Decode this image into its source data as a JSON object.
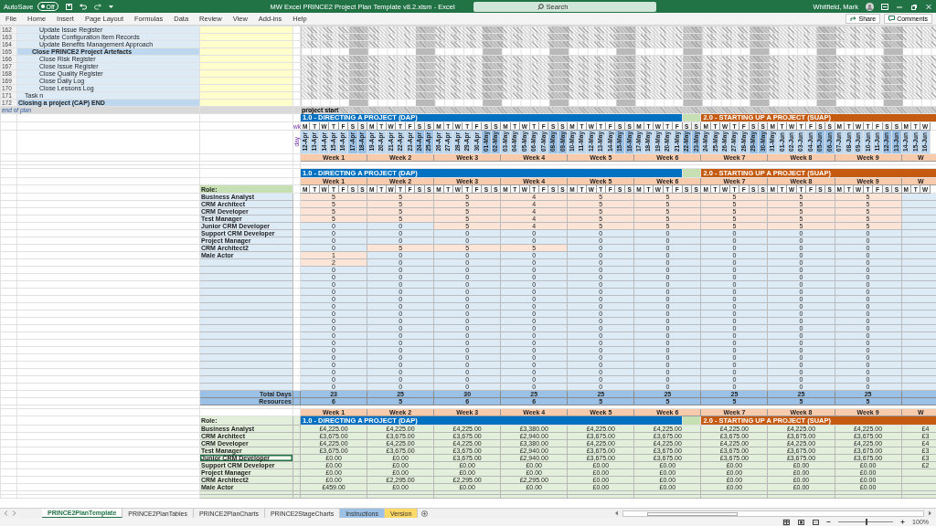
{
  "title_bar": {
    "autosave_label": "AutoSave",
    "autosave": {
      "label": "Off",
      "on": false
    },
    "title": "MW Excel PRINCE2 Project Plan Template v8.2.xlsm  -  Excel",
    "search": {
      "placeholder": "Search"
    },
    "user": "Whitfield, Mark"
  },
  "ribbon_tabs": [
    "File",
    "Home",
    "Insert",
    "Page Layout",
    "Formulas",
    "Data",
    "Review",
    "View",
    "Add-ins",
    "Help"
  ],
  "ribbon_buttons": [
    "Share",
    "Comments"
  ],
  "task_rows": [
    {
      "row": "162",
      "text": "Update Issue Register",
      "kind": "task"
    },
    {
      "row": "163",
      "text": "Update Configuration Item Records",
      "kind": "task"
    },
    {
      "row": "164",
      "text": "Update Benefits Management Approach",
      "kind": "task"
    },
    {
      "row": "165",
      "text": "Close PRINCE2 Project Artefacts",
      "kind": "activity",
      "children": [
        {
          "row": "166",
          "text": "Close Risk Register",
          "kind": "task"
        },
        {
          "row": "167",
          "text": "Close Issue Register",
          "kind": "task"
        },
        {
          "row": "168",
          "text": "Close Quality Register",
          "kind": "task"
        },
        {
          "row": "169",
          "text": "Close Daily Log",
          "kind": "task"
        },
        {
          "row": "170",
          "text": "Close Lessons Log",
          "kind": "task"
        }
      ]
    },
    {
      "row": "171",
      "text": "Task n",
      "kind": "custom"
    },
    {
      "row": "172",
      "text": "Closing a project (CAP) END",
      "kind": "process_end"
    }
  ],
  "end_of_plan": "end of plan",
  "project_start": "project start",
  "timeline": {
    "row_labels": [
      "wk",
      "day"
    ],
    "phases": [
      {
        "label": "1.0 - DIRECTING A PROJECT (DAP)",
        "color": "#0070c0"
      },
      {
        "label": "2.0 - STARTING UP A PROJECT (SUAP)",
        "color": "#c55a11"
      }
    ],
    "weeks": [
      {
        "label": "Week 1",
        "days": [
          "M",
          "T",
          "W",
          "T",
          "F",
          "S",
          "S"
        ],
        "dates": [
          "12-Apr",
          "13-Apr",
          "14-Apr",
          "15-Apr",
          "16-Apr",
          "17-Apr",
          "18-Apr"
        ]
      },
      {
        "label": "Week 2",
        "days": [
          "M",
          "T",
          "W",
          "T",
          "F",
          "S",
          "S"
        ],
        "dates": [
          "19-Apr",
          "20-Apr",
          "21-Apr",
          "22-Apr",
          "23-Apr",
          "24-Apr",
          "25-Apr"
        ]
      },
      {
        "label": "Week 3",
        "days": [
          "M",
          "T",
          "W",
          "T",
          "F",
          "S",
          "S"
        ],
        "dates": [
          "26-Apr",
          "27-Apr",
          "28-Apr",
          "29-Apr",
          "30-Apr",
          "01-May",
          "02-May"
        ]
      },
      {
        "label": "Week 4",
        "days": [
          "M",
          "T",
          "W",
          "T",
          "F",
          "S",
          "S"
        ],
        "dates": [
          "03-May",
          "04-May",
          "05-May",
          "06-May",
          "07-May",
          "08-May",
          "09-May"
        ]
      },
      {
        "label": "Week 5",
        "days": [
          "M",
          "T",
          "W",
          "T",
          "F",
          "S",
          "S"
        ],
        "dates": [
          "10-May",
          "11-May",
          "12-May",
          "13-May",
          "14-May",
          "15-May",
          "16-May"
        ]
      },
      {
        "label": "Week 6",
        "days": [
          "M",
          "T",
          "W",
          "T",
          "F",
          "S",
          "S"
        ],
        "dates": [
          "17-May",
          "18-May",
          "19-May",
          "20-May",
          "21-May",
          "22-May",
          "23-May"
        ]
      },
      {
        "label": "Week 7",
        "days": [
          "M",
          "T",
          "W",
          "T",
          "F",
          "S",
          "S"
        ],
        "dates": [
          "24-May",
          "25-May",
          "26-May",
          "27-May",
          "28-May",
          "29-May",
          "30-May"
        ]
      },
      {
        "label": "Week 8",
        "days": [
          "M",
          "T",
          "W",
          "T",
          "F",
          "S",
          "S"
        ],
        "dates": [
          "31-May",
          "01-Jun",
          "02-Jun",
          "03-Jun",
          "04-Jun",
          "05-Jun",
          "06-Jun"
        ]
      },
      {
        "label": "Week 9",
        "days": [
          "M",
          "T",
          "W",
          "T",
          "F",
          "S",
          "S"
        ],
        "dates": [
          "07-Jun",
          "08-Jun",
          "09-Jun",
          "10-Jun",
          "11-Jun",
          "12-Jun",
          "13-Jun"
        ]
      },
      {
        "label": "W",
        "days": [
          "M",
          "T",
          "W"
        ],
        "dates": [
          "14-Jun",
          "15-Jun",
          "16-Jun"
        ]
      }
    ]
  },
  "resources": {
    "phases": [
      {
        "label": "1.0 - DIRECTING A PROJECT (DAP)",
        "color": "#0070c0"
      },
      {
        "label": "2.0 - STARTING UP A PROJECT (SUAP)",
        "color": "#c55a11"
      }
    ],
    "weeks": [
      {
        "label": "Week 1",
        "days": [
          "M",
          "T",
          "W",
          "T",
          "F",
          "S",
          "S"
        ]
      },
      {
        "label": "Week 2",
        "days": [
          "M",
          "T",
          "W",
          "T",
          "F",
          "S",
          "S"
        ]
      },
      {
        "label": "Week 3",
        "days": [
          "M",
          "T",
          "W",
          "T",
          "F",
          "S",
          "S"
        ]
      },
      {
        "label": "Week 4",
        "days": [
          "M",
          "T",
          "W",
          "T",
          "F",
          "S",
          "S"
        ]
      },
      {
        "label": "Week 5",
        "days": [
          "M",
          "T",
          "W",
          "T",
          "F",
          "S",
          "S"
        ]
      },
      {
        "label": "Week 6",
        "days": [
          "M",
          "T",
          "W",
          "T",
          "F",
          "S",
          "S"
        ]
      },
      {
        "label": "Week 7",
        "days": [
          "M",
          "T",
          "W",
          "T",
          "F",
          "S",
          "S"
        ]
      },
      {
        "label": "Week 8",
        "days": [
          "M",
          "T",
          "W",
          "T",
          "F",
          "S",
          "S"
        ]
      },
      {
        "label": "Week 9",
        "days": [
          "M",
          "T",
          "W",
          "T",
          "F",
          "S",
          "S"
        ]
      },
      {
        "label": "W",
        "days": [
          "M",
          "T",
          "W"
        ]
      }
    ],
    "role_label": "Role:",
    "rows": [
      {
        "role": "Business Analyst",
        "values": [
          "5",
          "5",
          "5",
          "4",
          "5",
          "5",
          "5",
          "5",
          "5"
        ]
      },
      {
        "role": "CRM Architect",
        "values": [
          "5",
          "5",
          "5",
          "4",
          "5",
          "5",
          "5",
          "5",
          "5"
        ]
      },
      {
        "role": "CRM Developer",
        "values": [
          "5",
          "5",
          "5",
          "4",
          "5",
          "5",
          "5",
          "5",
          "5"
        ]
      },
      {
        "role": "Test Manager",
        "values": [
          "5",
          "5",
          "5",
          "4",
          "5",
          "5",
          "5",
          "5",
          "5"
        ]
      },
      {
        "role": "Junior CRM Developer",
        "values": [
          "0",
          "0",
          "5",
          "4",
          "5",
          "5",
          "5",
          "5",
          "5"
        ]
      },
      {
        "role": "Support CRM Developer",
        "values": [
          "0",
          "0",
          "0",
          "0",
          "0",
          "0",
          "0",
          "0",
          "0"
        ]
      },
      {
        "role": "Project Manager",
        "values": [
          "0",
          "0",
          "0",
          "0",
          "0",
          "0",
          "0",
          "0",
          "0"
        ]
      },
      {
        "role": "CRM Architect2",
        "values": [
          "0",
          "5",
          "5",
          "5",
          "0",
          "0",
          "0",
          "0",
          "0"
        ]
      },
      {
        "role": "Male Actor",
        "values": [
          "1",
          "0",
          "0",
          "0",
          "0",
          "0",
          "0",
          "0",
          "0"
        ]
      },
      {
        "values": [
          "2",
          "0",
          "0",
          "0",
          "0",
          "0",
          "0",
          "0",
          "0"
        ]
      },
      {
        "values": [
          "0",
          "0",
          "0",
          "0",
          "0",
          "0",
          "0",
          "0",
          "0"
        ]
      },
      {
        "values": [
          "0",
          "0",
          "0",
          "0",
          "0",
          "0",
          "0",
          "0",
          "0"
        ]
      },
      {
        "values": [
          "0",
          "0",
          "0",
          "0",
          "0",
          "0",
          "0",
          "0",
          "0"
        ]
      },
      {
        "values": [
          "0",
          "0",
          "0",
          "0",
          "0",
          "0",
          "0",
          "0",
          "0"
        ]
      },
      {
        "values": [
          "0",
          "0",
          "0",
          "0",
          "0",
          "0",
          "0",
          "0",
          "0"
        ]
      },
      {
        "values": [
          "0",
          "0",
          "0",
          "0",
          "0",
          "0",
          "0",
          "0",
          "0"
        ]
      },
      {
        "values": [
          "0",
          "0",
          "0",
          "0",
          "0",
          "0",
          "0",
          "0",
          "0"
        ]
      },
      {
        "values": [
          "0",
          "0",
          "0",
          "0",
          "0",
          "0",
          "0",
          "0",
          "0"
        ]
      },
      {
        "values": [
          "0",
          "0",
          "0",
          "0",
          "0",
          "0",
          "0",
          "0",
          "0"
        ]
      },
      {
        "values": [
          "0",
          "0",
          "0",
          "0",
          "0",
          "0",
          "0",
          "0",
          "0"
        ]
      },
      {
        "values": [
          "0",
          "0",
          "0",
          "0",
          "0",
          "0",
          "0",
          "0",
          "0"
        ]
      },
      {
        "values": [
          "0",
          "0",
          "0",
          "0",
          "0",
          "0",
          "0",
          "0",
          "0"
        ]
      },
      {
        "values": [
          "0",
          "0",
          "0",
          "0",
          "0",
          "0",
          "0",
          "0",
          "0"
        ]
      },
      {
        "values": [
          "0",
          "0",
          "0",
          "0",
          "0",
          "0",
          "0",
          "0",
          "0"
        ]
      },
      {
        "values": [
          "0",
          "0",
          "0",
          "0",
          "0",
          "0",
          "0",
          "0",
          "0"
        ]
      },
      {
        "values": [
          "0",
          "0",
          "0",
          "0",
          "0",
          "0",
          "0",
          "0",
          "0"
        ]
      },
      {
        "values": [
          "0",
          "0",
          "0",
          "0",
          "0",
          "0",
          "0",
          "0",
          "0"
        ]
      }
    ],
    "totals": [
      {
        "label": "Total Days",
        "values": [
          "23",
          "25",
          "30",
          "25",
          "25",
          "25",
          "25",
          "25",
          "25"
        ]
      },
      {
        "label": "Resources",
        "values": [
          "6",
          "5",
          "6",
          "6",
          "5",
          "5",
          "5",
          "5",
          "5"
        ]
      }
    ]
  },
  "costs": {
    "weeks": [
      "Week 1",
      "Week 2",
      "Week 3",
      "Week 4",
      "Week 5",
      "Week 6",
      "Week 7",
      "Week 8",
      "Week 9",
      "W"
    ],
    "role_label": "Role:",
    "phases": [
      {
        "label": "1.0 - DIRECTING A PROJECT (DAP)",
        "color": "#0070c0"
      },
      {
        "label": "2.0 - STARTING UP A PROJECT (SUAP)",
        "color": "#c55a11"
      }
    ],
    "rows": [
      {
        "role": "Business Analyst",
        "selected": false,
        "values": [
          "£4,225.00",
          "£4,225.00",
          "£4,225.00",
          "£3,380.00",
          "£4,225.00",
          "£4,225.00",
          "£4,225.00",
          "£4,225.00",
          "£4,225.00",
          "£4"
        ]
      },
      {
        "role": "CRM Architect",
        "selected": false,
        "values": [
          "£3,675.00",
          "£3,675.00",
          "£3,675.00",
          "£2,940.00",
          "£3,675.00",
          "£3,675.00",
          "£3,675.00",
          "£3,675.00",
          "£3,675.00",
          "£3"
        ]
      },
      {
        "role": "CRM Developer",
        "selected": false,
        "values": [
          "£4,225.00",
          "£4,225.00",
          "£4,225.00",
          "£3,380.00",
          "£4,225.00",
          "£4,225.00",
          "£4,225.00",
          "£4,225.00",
          "£4,225.00",
          "£4"
        ]
      },
      {
        "role": "Test Manager",
        "selected": false,
        "values": [
          "£3,675.00",
          "£3,675.00",
          "£3,675.00",
          "£2,940.00",
          "£3,675.00",
          "£3,675.00",
          "£3,675.00",
          "£3,675.00",
          "£3,675.00",
          "£3"
        ]
      },
      {
        "role": "Junior CRM Developer",
        "selected": true,
        "values": [
          "£0.00",
          "£0.00",
          "£3,675.00",
          "£2,940.00",
          "£3,675.00",
          "£3,675.00",
          "£3,675.00",
          "£3,675.00",
          "£3,675.00",
          "£3"
        ]
      },
      {
        "role": "Support CRM Developer",
        "selected": false,
        "values": [
          "£0.00",
          "£0.00",
          "£0.00",
          "£0.00",
          "£0.00",
          "£0.00",
          "£0.00",
          "£0.00",
          "£0.00",
          "£2"
        ]
      },
      {
        "role": "Project Manager",
        "selected": false,
        "values": [
          "£0.00",
          "£0.00",
          "£0.00",
          "£0.00",
          "£0.00",
          "£0.00",
          "£0.00",
          "£0.00",
          "£0.00"
        ]
      },
      {
        "role": "CRM Architect2",
        "selected": false,
        "values": [
          "£0.00",
          "£2,295.00",
          "£2,295.00",
          "£2,295.00",
          "£0.00",
          "£0.00",
          "£0.00",
          "£0.00",
          "£0.00"
        ]
      },
      {
        "role": "Male Actor",
        "selected": false,
        "values": [
          "£459.00",
          "£0.00",
          "£0.00",
          "£0.00",
          "£0.00",
          "£0.00",
          "£0.00",
          "£0.00",
          "£0.00"
        ]
      }
    ]
  },
  "sheet_tabs": [
    {
      "label": "PRINCE2PlanTemplate",
      "selected": true
    },
    {
      "label": "PRINCE2PlanTables",
      "selected": false
    },
    {
      "label": "PRINCE2PlanCharts",
      "selected": false
    },
    {
      "label": "PRINCE2StageCharts",
      "selected": false
    },
    {
      "label": "Instructions",
      "selected": false,
      "color": "#9bc2e6"
    },
    {
      "label": "Version",
      "selected": false,
      "color": "#ffd966"
    }
  ],
  "status_bar": {
    "views": [
      {
        "kind": "normal",
        "selected": true
      },
      {
        "kind": "page_layout",
        "selected": false
      },
      {
        "kind": "page_break",
        "selected": false
      }
    ],
    "zoom": {
      "level": 0.5,
      "label": "100%"
    }
  }
}
